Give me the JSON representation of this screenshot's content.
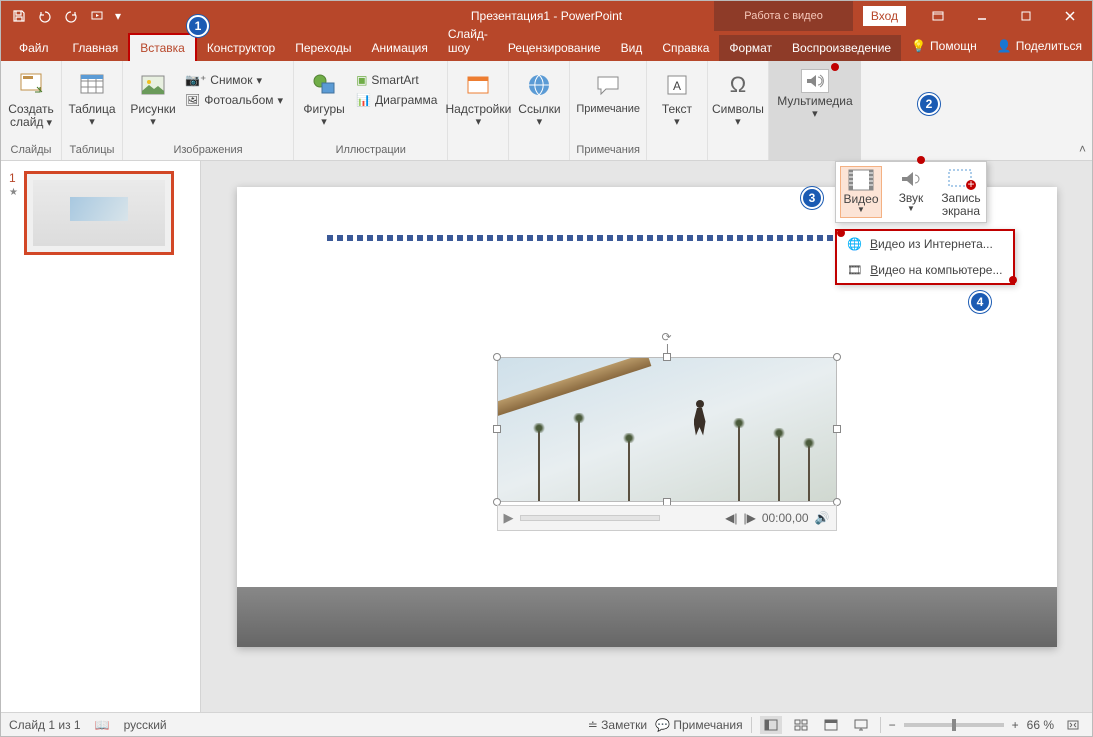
{
  "title": "Презентация1 - PowerPoint",
  "context_tab": "Работа с видео",
  "login": "Вход",
  "tabs": {
    "file": "Файл",
    "home": "Главная",
    "insert": "Вставка",
    "design": "Конструктор",
    "transitions": "Переходы",
    "animation": "Анимация",
    "slideshow": "Слайд-шоу",
    "review": "Рецензирование",
    "view": "Вид",
    "help": "Справка",
    "format": "Формат",
    "playback": "Воспроизведение",
    "tell_me": "Помощн",
    "share": "Поделиться"
  },
  "ribbon": {
    "slides": {
      "new_slide": "Создать слайд",
      "group": "Слайды"
    },
    "tables": {
      "table": "Таблица",
      "group": "Таблицы"
    },
    "images": {
      "pictures": "Рисунки",
      "screenshot": "Снимок",
      "album": "Фотоальбом",
      "group": "Изображения"
    },
    "illus": {
      "shapes": "Фигуры",
      "smartart": "SmartArt",
      "chart": "Диаграмма",
      "group": "Иллюстрации"
    },
    "addins": {
      "addins": "Надстройки"
    },
    "links": {
      "links": "Ссылки"
    },
    "comments": {
      "comment": "Примечание",
      "group": "Примечания"
    },
    "text": {
      "text": "Текст"
    },
    "symbols": {
      "symbols": "Символы"
    },
    "media": {
      "media": "Мультимедиа"
    }
  },
  "media_dd": {
    "video": "Видео",
    "audio": "Звук",
    "screen": "Запись экрана",
    "online": "Видео из Интернета...",
    "pc": "Видео на компьютере..."
  },
  "player": {
    "time": "00:00,00"
  },
  "thumb": {
    "num": "1"
  },
  "status": {
    "slide": "Слайд 1 из 1",
    "lang": "русский",
    "notes": "Заметки",
    "comments": "Примечания",
    "zoom": "66 %"
  }
}
